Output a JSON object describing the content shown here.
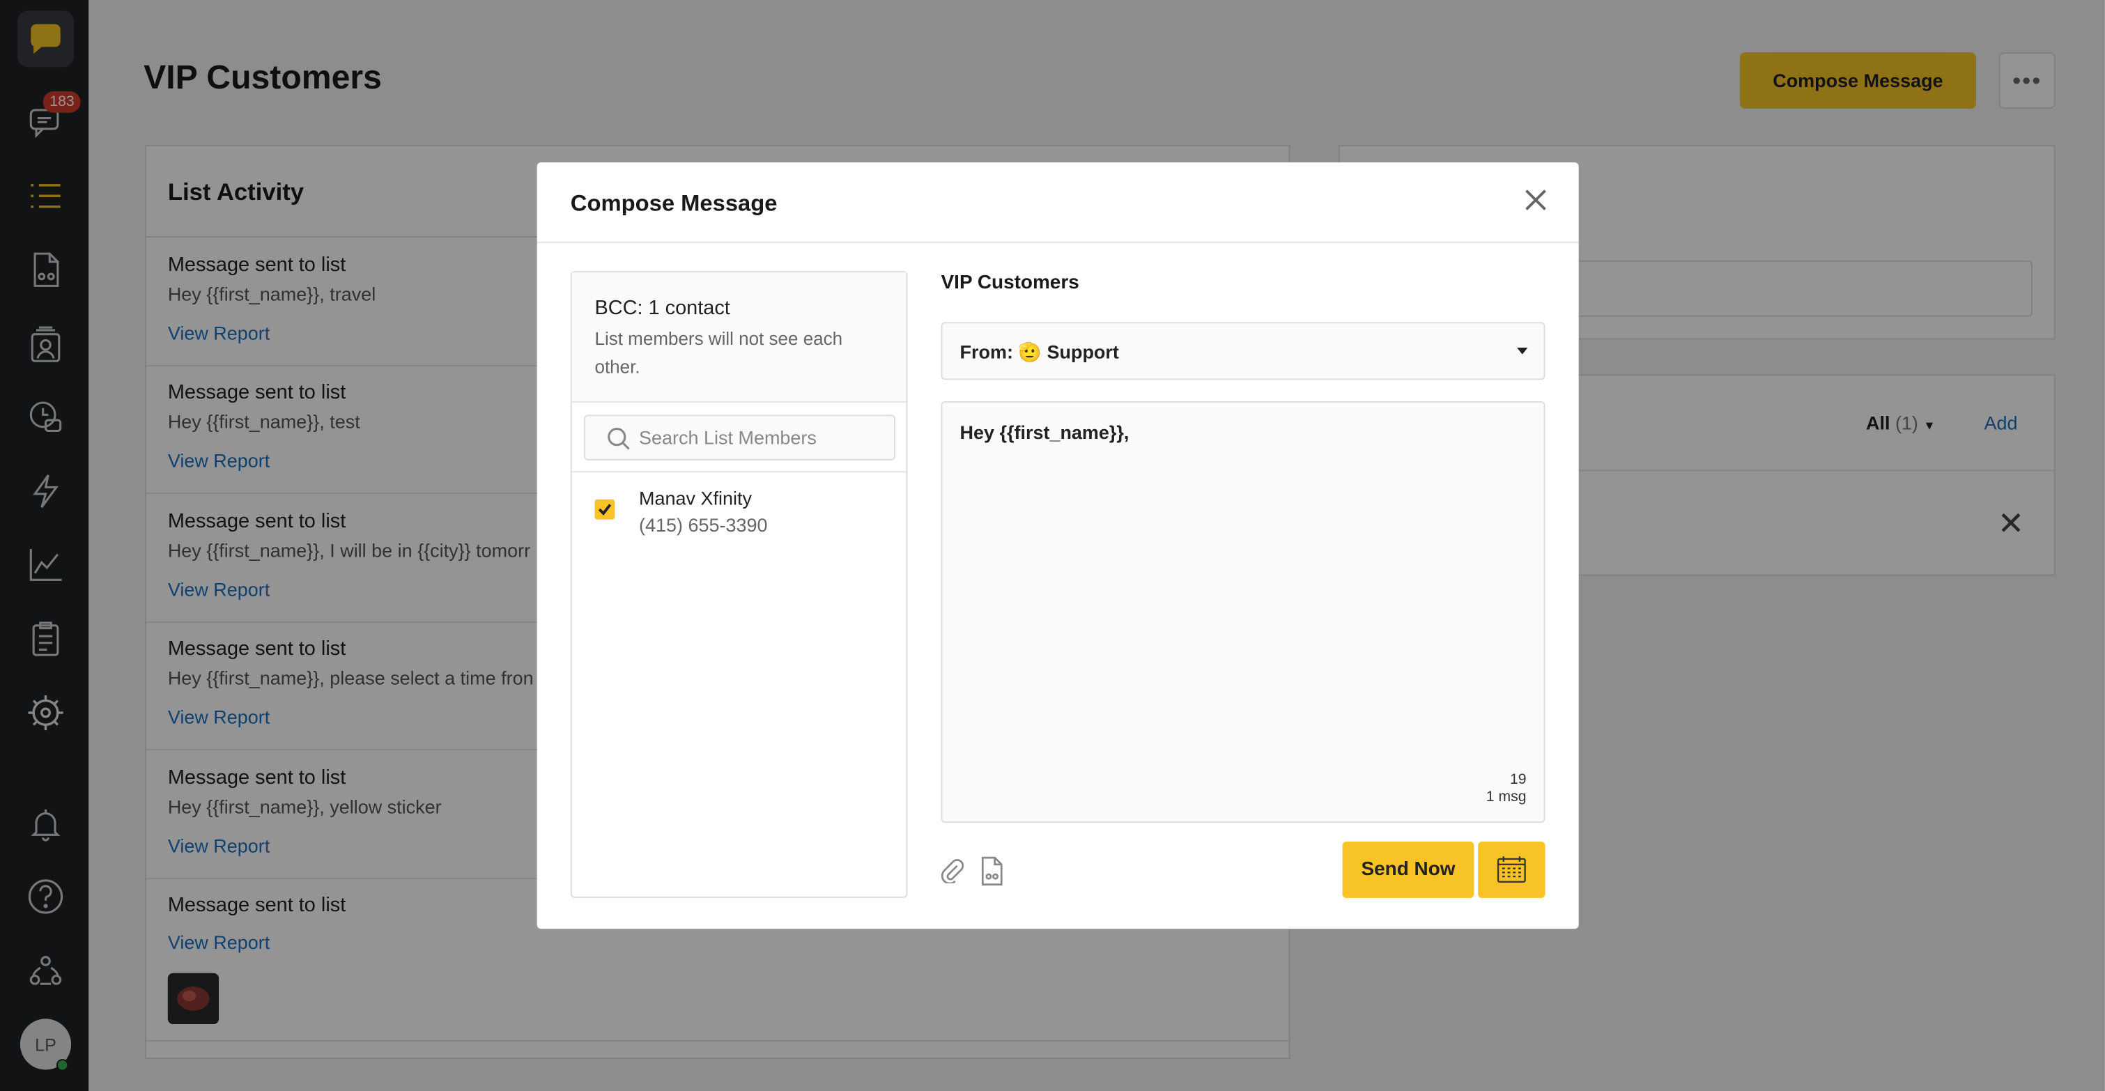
{
  "sidebar": {
    "unread_badge": "183",
    "avatar_initials": "LP",
    "items": [
      {
        "icon": "chat-bubble-logo-icon"
      },
      {
        "icon": "conversations-icon"
      },
      {
        "icon": "lists-icon"
      },
      {
        "icon": "document-icon"
      },
      {
        "icon": "contacts-icon"
      },
      {
        "icon": "history-icon"
      },
      {
        "icon": "automation-icon"
      },
      {
        "icon": "analytics-icon"
      },
      {
        "icon": "tasks-icon"
      },
      {
        "icon": "settings-icon"
      },
      {
        "icon": "notifications-icon"
      },
      {
        "icon": "help-icon"
      },
      {
        "icon": "team-icon"
      }
    ]
  },
  "page": {
    "title": "VIP Customers",
    "compose_button": "Compose Message",
    "more_button": "•••"
  },
  "activity": {
    "title": "List Activity",
    "items": [
      {
        "title": "Message sent to list",
        "text": "Hey {{first_name}}, travel",
        "link": "View Report"
      },
      {
        "title": "Message sent to list",
        "text": "Hey {{first_name}}, test",
        "link": "View Report"
      },
      {
        "title": "Message sent to list",
        "text": "Hey {{first_name}}, I will be in {{city}} tomorr",
        "link": "View Report"
      },
      {
        "title": "Message sent to list",
        "text": "Hey {{first_name}}, please select a time fron",
        "link": "View Report"
      },
      {
        "title": "Message sent to list",
        "text": "Hey {{first_name}}, yellow sticker",
        "link": "View Report"
      },
      {
        "title": "Message sent to list",
        "text": "",
        "link": "View Report"
      }
    ]
  },
  "right_panel": {
    "filter_label": "All",
    "filter_count": "(1)",
    "add_label": "Add",
    "close_symbol": "✕"
  },
  "modal": {
    "title": "Compose Message",
    "bcc_title": "BCC: 1 contact",
    "bcc_note": "List members will not see each other.",
    "search_placeholder": "Search List Members",
    "member": {
      "name": "Manav Xfinity",
      "phone": "(415) 655-3390",
      "checked": true
    },
    "list_name": "VIP Customers",
    "from_label": "From: 🫡 Support",
    "message": "Hey {{first_name}},",
    "char_count": "19",
    "msg_count": "1 msg",
    "send_button": "Send Now"
  },
  "colors": {
    "accent": "#f7c326",
    "link": "#1a6fc1",
    "sidebar": "#1f2124",
    "badge": "#d23b2b"
  }
}
